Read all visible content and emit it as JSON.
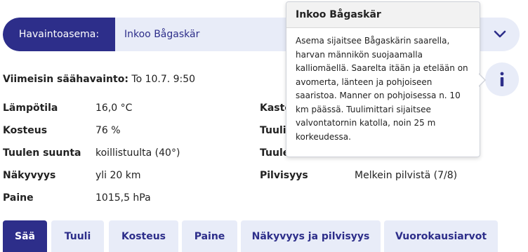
{
  "selector": {
    "label": "Havaintoasema:",
    "value": "Inkoo Bågaskär"
  },
  "latest": {
    "label": "Viimeisin säähavainto:",
    "value": "To 10.7. 9:50"
  },
  "observations_left": [
    {
      "key": "Lämpötila",
      "value": "16,0 °C"
    },
    {
      "key": "Kosteus",
      "value": "76 %"
    },
    {
      "key": "Tuulen suunta",
      "value": "koillistuulta (40°)"
    },
    {
      "key": "Näkyvyys",
      "value": "yli 20 km"
    },
    {
      "key": "Paine",
      "value": "1015,5 hPa"
    }
  ],
  "observations_right_visible": [
    {
      "key": "Kaste",
      "value": ""
    },
    {
      "key": "Tuuli",
      "value": ""
    },
    {
      "key": "Tuule",
      "value": ""
    },
    {
      "key": "Pilvisyys",
      "value": "Melkein pilvistä (7/8)"
    }
  ],
  "popover": {
    "title": "Inkoo Bågaskär",
    "lines": [
      "Asema sijaitsee Bågaskärin saarella,",
      "harvan männikön suojaamalla",
      "kalliomäellä. Saarelta itään ja etelään on",
      "avomerta, länteen ja pohjoiseen",
      "saaristoa. Manner on pohjoisessa n. 10",
      "km päässä. Tuulimittari sijaitsee",
      "valvontatornin katolla, noin 25 m",
      "korkeudessa."
    ]
  },
  "tabs": [
    {
      "label": "Sää",
      "active": true
    },
    {
      "label": "Tuuli",
      "active": false
    },
    {
      "label": "Kosteus",
      "active": false
    },
    {
      "label": "Paine",
      "active": false
    },
    {
      "label": "Näkyvyys ja pilvisyys",
      "active": false
    },
    {
      "label": "Vuorokausiarvot",
      "active": false
    }
  ],
  "colors": {
    "brand": "#2d2e8a",
    "pill_bg": "#e8ecf8"
  },
  "icons": {
    "dropdown": "chevron-down-icon",
    "info": "info-icon"
  }
}
